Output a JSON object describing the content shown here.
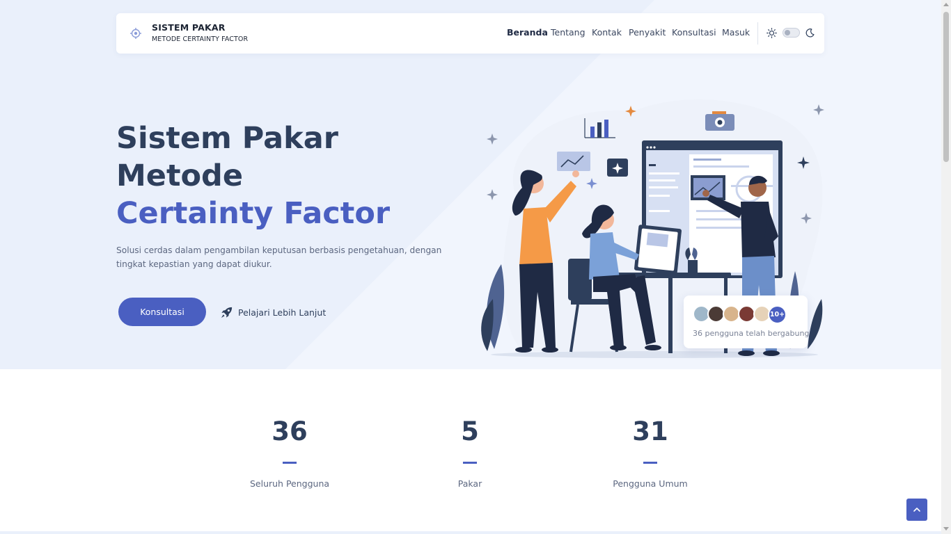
{
  "brand": {
    "title": "SISTEM PAKAR",
    "subtitle": "METODE CERTAINTY FACTOR",
    "icon": "gear-logo-icon"
  },
  "nav": {
    "items": [
      {
        "label": "Beranda",
        "active": true
      },
      {
        "label": "Tentang",
        "active": false
      },
      {
        "label": "Kontak",
        "active": false
      },
      {
        "label": "Penyakit",
        "active": false
      },
      {
        "label": "Konsultasi",
        "active": false
      },
      {
        "label": "Masuk",
        "active": false
      }
    ],
    "theme_light_icon": "sun-icon",
    "theme_dark_icon": "moon-icon",
    "theme_toggle_on": false
  },
  "hero": {
    "title_line1": "Sistem Pakar",
    "title_line2": "Metode",
    "title_line3": "Certainty Factor",
    "description": "Solusi cerdas dalam pengambilan keputusan berbasis pengetahuan, dengan tingkat kepastian yang dapat diukur.",
    "primary_button": "Konsultasi",
    "secondary_link": "Pelajari Lebih Lanjut",
    "secondary_icon": "rocket-icon"
  },
  "joined": {
    "more_badge": "10+",
    "text": "36 pengguna telah bergabung"
  },
  "stats": [
    {
      "value": "36",
      "label": "Seluruh Pengguna"
    },
    {
      "value": "5",
      "label": "Pakar"
    },
    {
      "value": "31",
      "label": "Pengguna Umum"
    }
  ],
  "colors": {
    "accent": "#4a5fc1",
    "heading": "#2e3f5c",
    "hero_bg": "#eaf0fb"
  }
}
